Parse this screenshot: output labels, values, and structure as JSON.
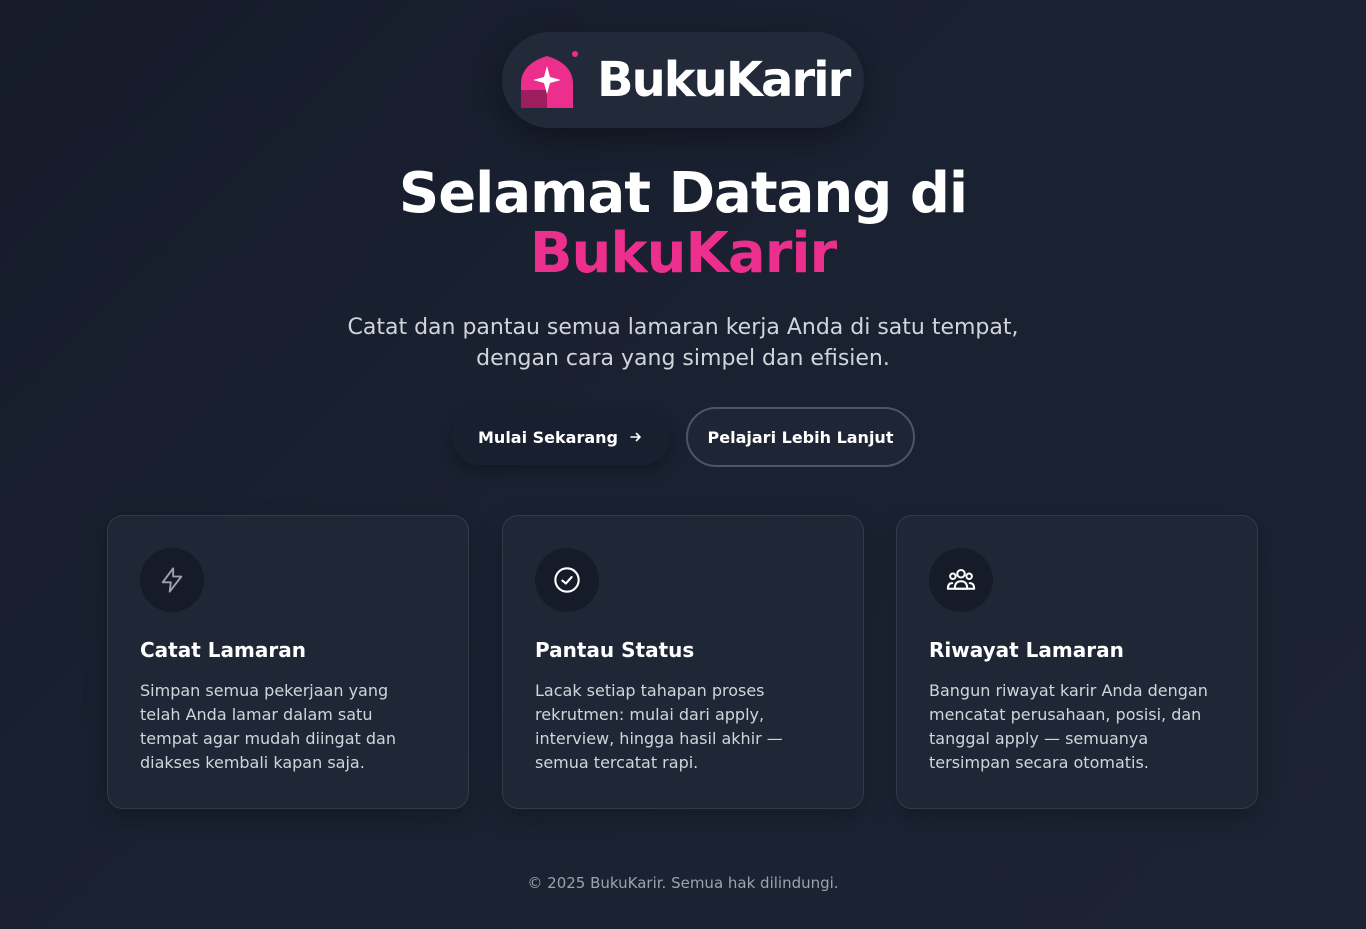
{
  "brand": {
    "name": "BukuKarir",
    "accent_color": "#ec2f8c",
    "logo_icon": "sparkle-house-logo-icon"
  },
  "hero": {
    "title_line1": "Selamat Datang di",
    "title_line2": "BukuKarir",
    "subtitle_line1": "Catat dan pantau semua lamaran kerja Anda di satu tempat,",
    "subtitle_line2": "dengan cara yang simpel dan efisien."
  },
  "actions": {
    "primary_label": "Mulai Sekarang",
    "primary_icon": "arrow-right-icon",
    "secondary_label": "Pelajari Lebih Lanjut"
  },
  "features": [
    {
      "icon": "lightning-icon",
      "title": "Catat Lamaran",
      "description": "Simpan semua pekerjaan yang telah Anda lamar dalam satu tempat agar mudah diingat dan diakses kembali kapan saja."
    },
    {
      "icon": "check-circle-icon",
      "title": "Pantau Status",
      "description": "Lacak setiap tahapan proses rekrutmen: mulai dari apply, interview, hingga hasil akhir — semua tercatat rapi."
    },
    {
      "icon": "user-group-icon",
      "title": "Riwayat Lamaran",
      "description": "Bangun riwayat karir Anda dengan mencatat perusahaan, posisi, dan tanggal apply — semuanya tersimpan secara otomatis."
    }
  ],
  "footer": {
    "text": "© 2025 BukuKarir. Semua hak dilindungi."
  }
}
